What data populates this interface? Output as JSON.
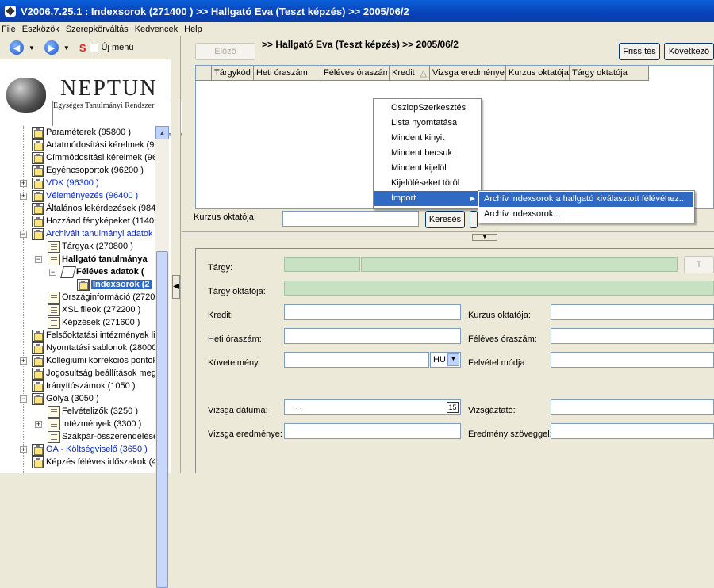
{
  "window": {
    "title": "V2006.7.25.1 : Indexsorok (271400  )  >> Hallgató Eva (Teszt képzés) >> 2005/06/2"
  },
  "menu": [
    "File",
    "Eszközök",
    "Szerepkörváltás",
    "Kedvencek",
    "Help"
  ],
  "nav": {
    "new_menu_label": "Új menü",
    "s_label": "S"
  },
  "logo": {
    "title": "NEPTUN",
    "subtitle": "Egységes Tanulmányi Rendszer"
  },
  "tree": [
    "Paraméterek (95800  )",
    "Adatmódosítási kérelmek (96",
    "Címmódosítási kérelmek (96",
    "Egyéncsoportok (96200  )",
    "VDK (96300  )",
    "Véleményezés (96400  )",
    "Általános lekérdezések (984",
    "Hozzáad fényképeket (1140",
    "Archivált tanulmányi adatok (",
    "Tárgyak (270800  )",
    "Hallgató tanulmánya",
    "Féléves adatok (",
    "Indexsorok (2",
    "Országinformáció (2720",
    "XSL fileok (272200  )",
    "Képzések (271600  )",
    "Felsőoktatási intézmények lis",
    "Nyomtatási sablonok (28000",
    "Kollégiumi korrekciós pontok",
    "Jogosultság beállítások meg",
    "Irányítószámok (1050  )",
    "Gólya (3050  )",
    "Felvételizők (3250  )",
    "Intézmények (3300  )",
    "Szakpár-összerendelése",
    "OA - Költségviselő (3650  )",
    "Képzés féléves időszakok (4"
  ],
  "main": {
    "prev_label": "Előző",
    "header": ">> Hallgató Eva (Teszt képzés) >> 2005/06/2",
    "refresh_label": "Frissítés",
    "next_label": "Következő",
    "columns": [
      "Tárgykód",
      "Heti óraszám",
      "Féléves óraszám",
      "Kredit",
      "Vizsga eredménye",
      "Kurzus oktatója",
      "Tárgy oktatója"
    ],
    "sort_glyph": "△",
    "search": {
      "label": "Kurzus oktatója:",
      "button": "Keresés"
    },
    "form": {
      "targy": "Tárgy:",
      "targy_oktatoja": "Tárgy oktatója:",
      "kredit": "Kredit:",
      "kurzus_oktatoja": "Kurzus oktatója:",
      "heti": "Heti óraszám:",
      "feleves": "Féléves óraszám:",
      "kovetelmeny": "Követelmény:",
      "kovetelmeny_value": "HU",
      "felvetel": "Felvétel módja:",
      "vizsga_datum": "Vizsga dátuma:",
      "vizsga_datum_value": ". .",
      "cal_glyph": "15",
      "vizsgaztato": "Vizsgáztató:",
      "vizsga_eredmeny": "Vizsga eredménye:",
      "eredmeny_szoveg": "Eredmény szöveggel:",
      "side_btn": "T"
    }
  },
  "context_menu": [
    "OszlopSzerkesztés",
    "Lista nyomtatása",
    "Mindent kinyit",
    "Mindent becsuk",
    "Mindent kijelöl",
    "Kijelöléseket töröl",
    "Import"
  ],
  "submenu": [
    "Archív indexsorok a hallgató kiválasztott félévéhez...",
    "Archív indexsorok..."
  ]
}
